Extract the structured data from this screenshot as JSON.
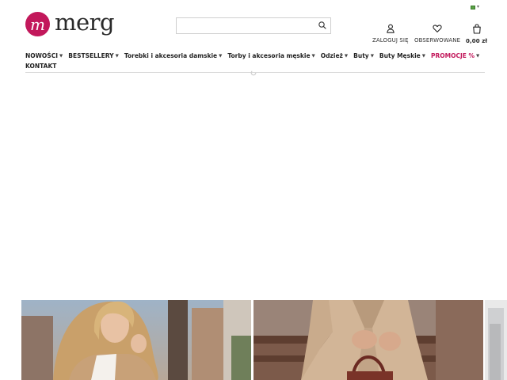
{
  "header": {
    "logo_text": "merg",
    "logo_mark": "m",
    "search": {
      "placeholder": ""
    },
    "account_links": [
      {
        "icon": "user-icon",
        "label": "ZALOGUJ SIĘ"
      },
      {
        "icon": "heart-icon",
        "label": "OBSERWOWANE"
      },
      {
        "icon": "bag-icon",
        "label": "0,00 zł"
      }
    ],
    "language": {
      "icon": "flag-icon"
    }
  },
  "nav": {
    "items": [
      {
        "label": "NOWOŚCI",
        "has_dropdown": true
      },
      {
        "label": "BESTSELLERY",
        "has_dropdown": true
      },
      {
        "label": "Torebki i akcesoria damskie",
        "has_dropdown": true
      },
      {
        "label": "Torby i akcesoria męskie",
        "has_dropdown": true
      },
      {
        "label": "Odzież",
        "has_dropdown": true
      },
      {
        "label": "Buty",
        "has_dropdown": true
      },
      {
        "label": "Buty Męskie",
        "has_dropdown": true
      },
      {
        "label": "PROMOCJE %",
        "has_dropdown": true,
        "highlight": true
      }
    ],
    "second_row": [
      {
        "label": "KONTAKT",
        "has_dropdown": false
      }
    ]
  },
  "colors": {
    "brand": "#c2185b",
    "text": "#222222",
    "border": "#d9d9d9"
  },
  "banners": [
    {
      "name": "woman-blonde-beige-coat-photo"
    },
    {
      "name": "beige-suit-handbag-photo"
    },
    {
      "name": "partial-banner-photo"
    }
  ]
}
